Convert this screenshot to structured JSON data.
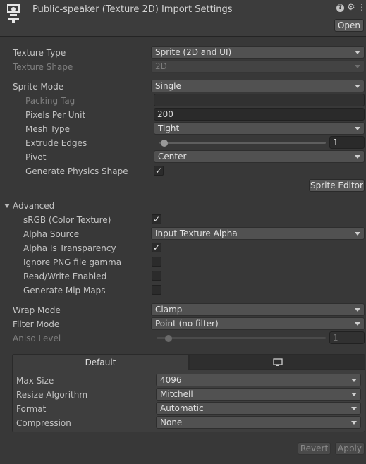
{
  "header": {
    "title": "Public-speaker (Texture 2D) Import Settings",
    "open_label": "Open",
    "help_glyph": "?",
    "icons": [
      "texture-asset-icon",
      "help-icon",
      "gear-icon",
      "kebab-menu-icon"
    ]
  },
  "texture": {
    "type_label": "Texture Type",
    "type_value": "Sprite (2D and UI)",
    "shape_label": "Texture Shape",
    "shape_value": "2D"
  },
  "sprite": {
    "mode_label": "Sprite Mode",
    "mode_value": "Single",
    "packing_tag_label": "Packing Tag",
    "packing_tag_value": "",
    "ppu_label": "Pixels Per Unit",
    "ppu_value": "200",
    "mesh_type_label": "Mesh Type",
    "mesh_type_value": "Tight",
    "extrude_label": "Extrude Edges",
    "extrude_value": "1",
    "extrude_fraction": 0.03,
    "pivot_label": "Pivot",
    "pivot_value": "Center",
    "physics_label": "Generate Physics Shape",
    "physics_checked": true,
    "editor_button": "Sprite Editor"
  },
  "advanced": {
    "label": "Advanced",
    "srgb_label": "sRGB (Color Texture)",
    "srgb_checked": true,
    "alpha_source_label": "Alpha Source",
    "alpha_source_value": "Input Texture Alpha",
    "alpha_transparency_label": "Alpha Is Transparency",
    "alpha_transparency_checked": true,
    "ignore_gamma_label": "Ignore PNG file gamma",
    "ignore_gamma_checked": false,
    "read_write_label": "Read/Write Enabled",
    "read_write_checked": false,
    "mipmaps_label": "Generate Mip Maps",
    "mipmaps_checked": false
  },
  "sampling": {
    "wrap_label": "Wrap Mode",
    "wrap_value": "Clamp",
    "filter_label": "Filter Mode",
    "filter_value": "Point (no filter)",
    "aniso_label": "Aniso Level",
    "aniso_value": "1",
    "aniso_fraction": 0.07
  },
  "platform": {
    "tab_default": "Default",
    "tab_standalone_icon": "monitor-icon",
    "max_size_label": "Max Size",
    "max_size_value": "4096",
    "resize_label": "Resize Algorithm",
    "resize_value": "Mitchell",
    "format_label": "Format",
    "format_value": "Automatic",
    "compression_label": "Compression",
    "compression_value": "None"
  },
  "footer": {
    "revert_label": "Revert",
    "apply_label": "Apply"
  },
  "check_glyph": "✓"
}
